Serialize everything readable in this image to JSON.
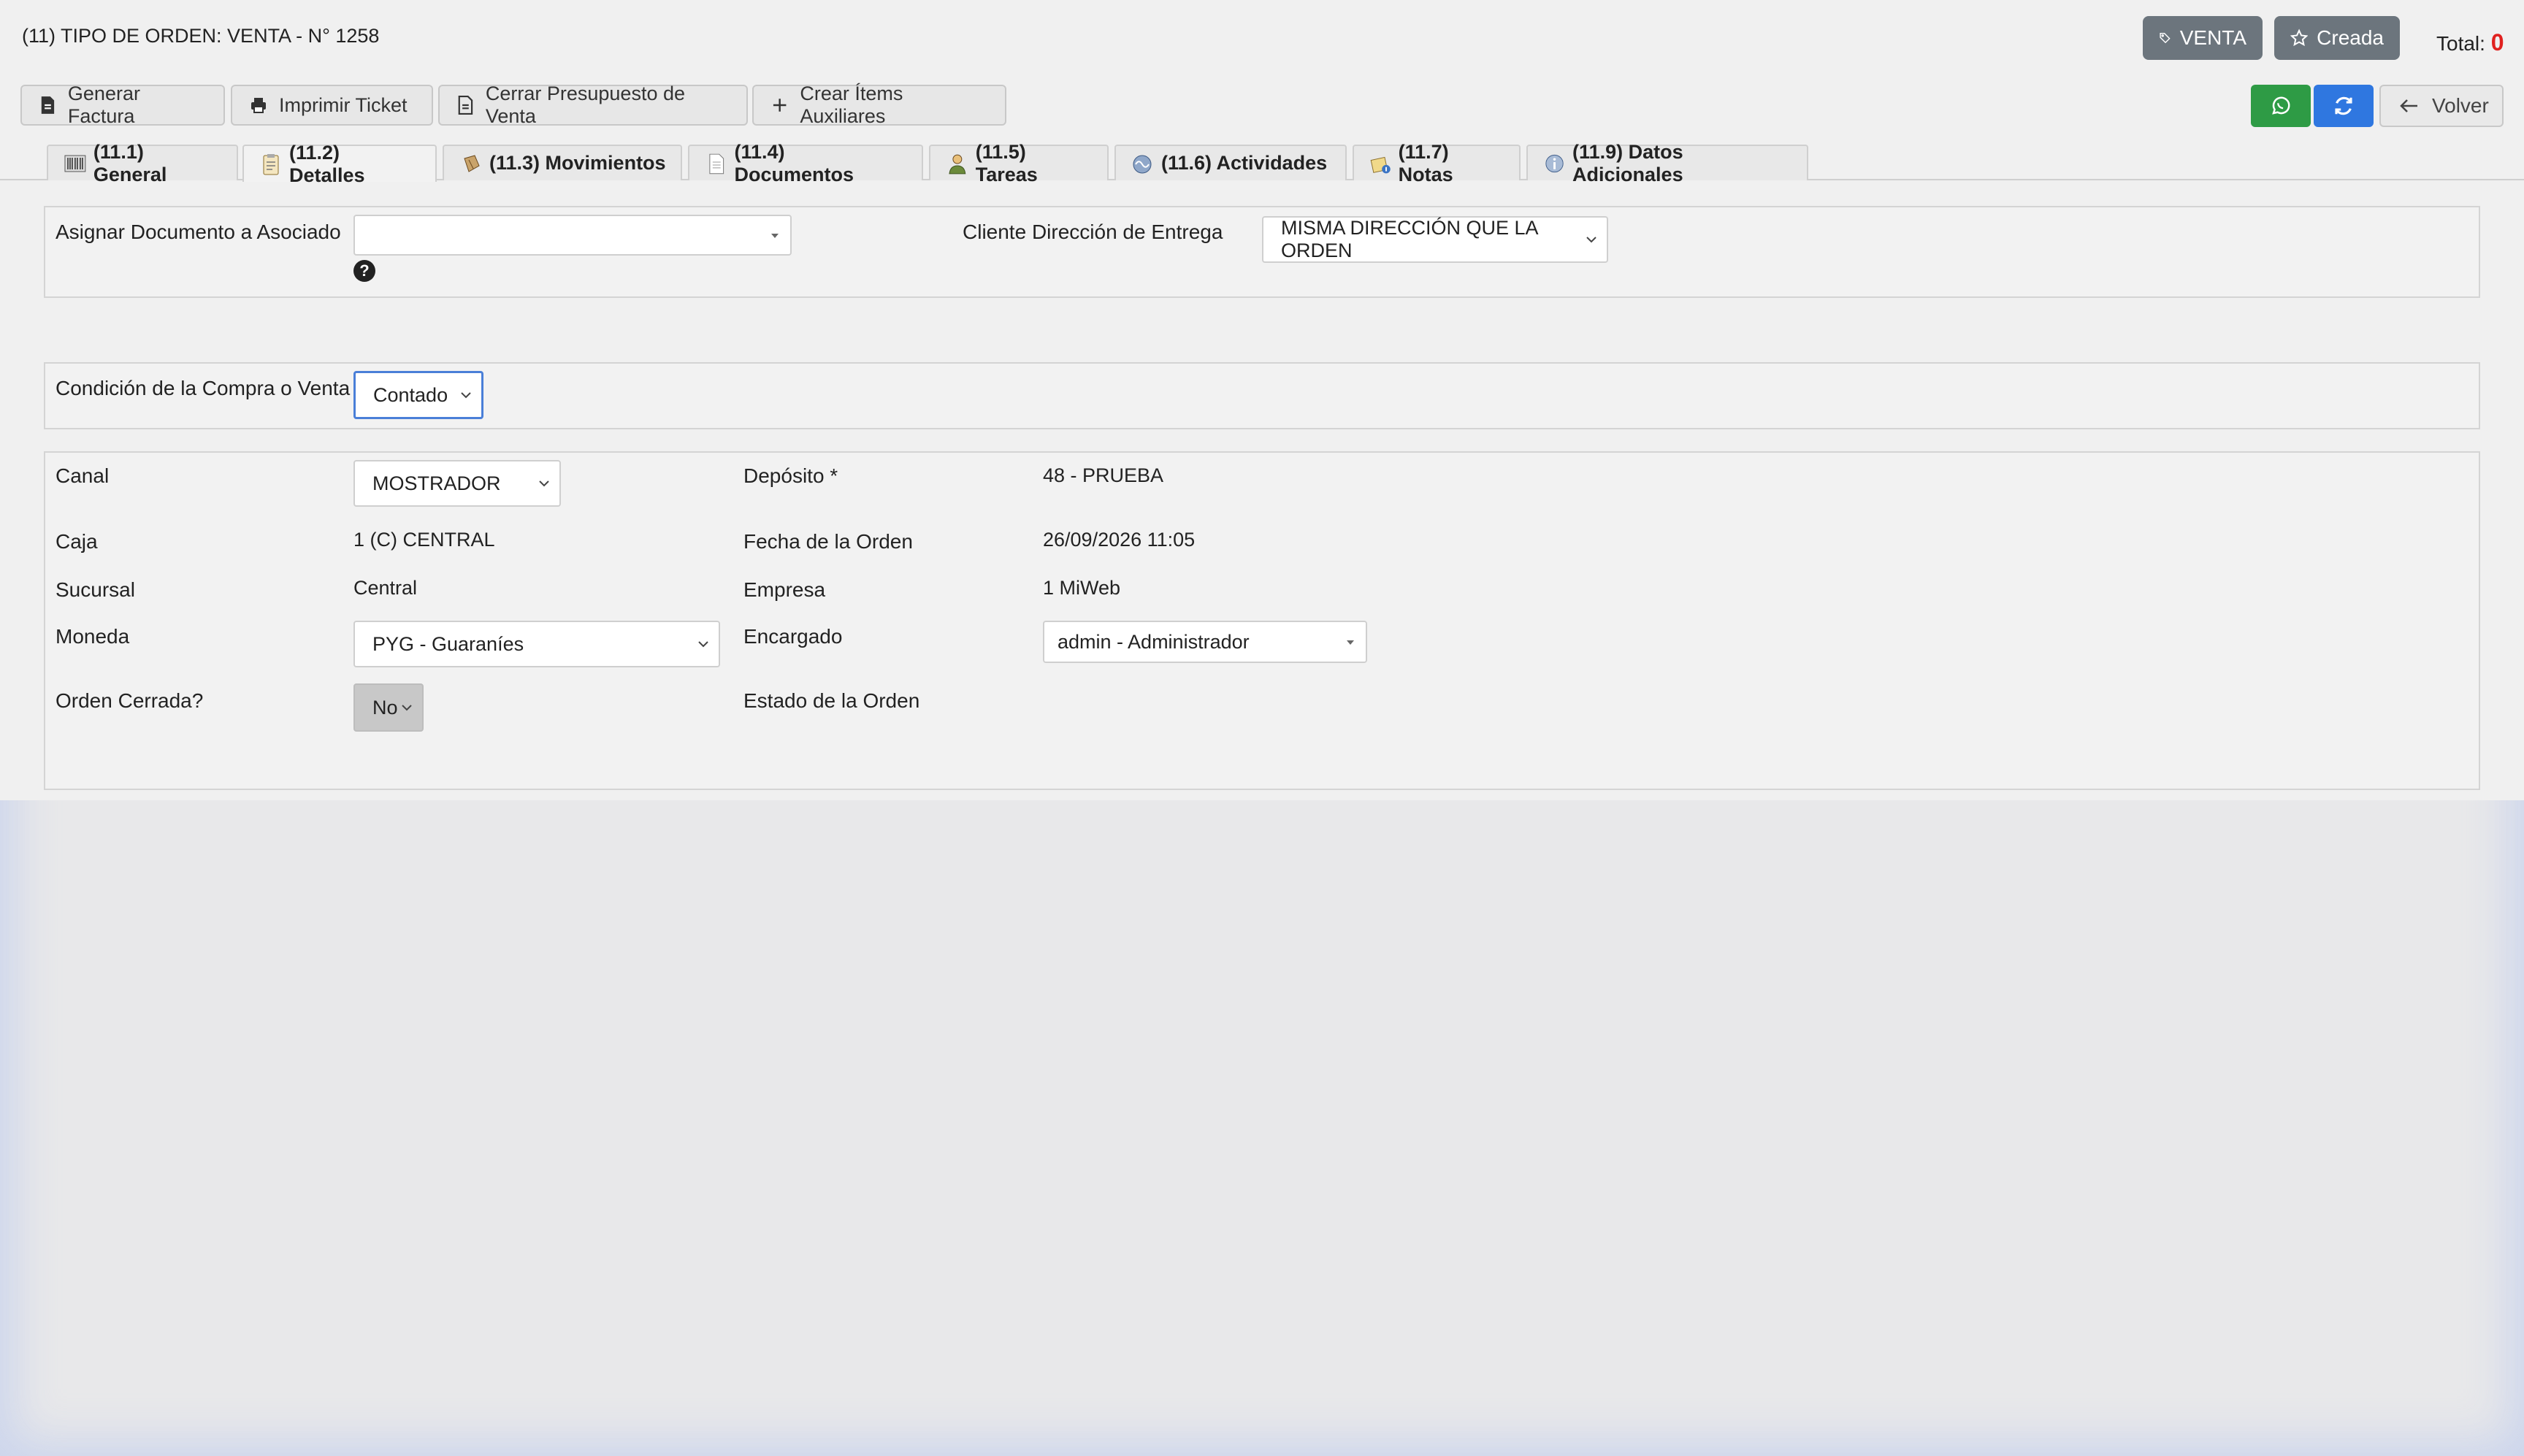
{
  "header": {
    "title": "(11) TIPO DE ORDEN: VENTA - N° 1258",
    "badges": {
      "type": "VENTA",
      "status": "Creada"
    },
    "total_label": "Total:",
    "total_value": "0"
  },
  "toolbar": {
    "generar_factura": "Generar Factura",
    "imprimir_ticket": "Imprimir Ticket",
    "cerrar_presupuesto": "Cerrar Presupuesto de Venta",
    "crear_items": "Crear Ítems Auxiliares",
    "volver": "Volver",
    "whatsapp_color": "#2e9b45",
    "refresh_color": "#2f77e0"
  },
  "tabs": [
    {
      "label": "(11.1) General",
      "icon": "barcode-icon"
    },
    {
      "label": "(11.2) Detalles",
      "icon": "clipboard-icon",
      "active": true
    },
    {
      "label": "(11.3) Movimientos",
      "icon": "package-icon"
    },
    {
      "label": "(11.4) Documentos",
      "icon": "document-icon"
    },
    {
      "label": "(11.5) Tareas",
      "icon": "user-icon"
    },
    {
      "label": "(11.6) Actividades",
      "icon": "activity-icon"
    },
    {
      "label": "(11.7) Notas",
      "icon": "notes-icon"
    },
    {
      "label": "(11.9) Datos Adicionales",
      "icon": "info-icon"
    }
  ],
  "asociado": {
    "label": "Asignar Documento a Asociado",
    "value": "",
    "help": "?"
  },
  "entrega": {
    "label": "Cliente Dirección de Entrega",
    "value": "MISMA DIRECCIÓN QUE LA ORDEN"
  },
  "condicion": {
    "label": "Condición de la Compra o Venta",
    "value": "Contado"
  },
  "details": {
    "canal": {
      "label": "Canal",
      "value": "MOSTRADOR"
    },
    "deposito": {
      "label": "Depósito *",
      "value": "48 - PRUEBA"
    },
    "caja": {
      "label": "Caja",
      "value": "1 (C) CENTRAL"
    },
    "fecha": {
      "label": "Fecha de la Orden",
      "value": "26/09/2026 11:05"
    },
    "sucursal": {
      "label": "Sucursal",
      "value": "Central"
    },
    "empresa": {
      "label": "Empresa",
      "value": "1 MiWeb"
    },
    "moneda": {
      "label": "Moneda",
      "value": "PYG - Guaraníes"
    },
    "encargado": {
      "label": "Encargado",
      "value": "admin - Administrador"
    },
    "cerrada": {
      "label": "Orden Cerrada?",
      "value": "No"
    },
    "estado": {
      "label": "Estado de la Orden",
      "value": ""
    }
  }
}
